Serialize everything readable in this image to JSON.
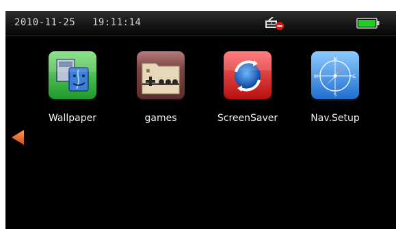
{
  "status_bar": {
    "date": "2010-11-25",
    "time": "19:11:14",
    "network_icon": "network-disconnected-icon",
    "battery_icon": "battery-full-icon"
  },
  "apps": [
    {
      "label": "Wallpaper",
      "icon": "wallpaper-icon"
    },
    {
      "label": "games",
      "icon": "games-icon"
    },
    {
      "label": "ScreenSaver",
      "icon": "screensaver-icon"
    },
    {
      "label": "Nav.Setup",
      "icon": "navigation-compass-icon"
    }
  ],
  "navigation": {
    "previous_arrow_icon": "arrow-left-icon"
  },
  "colors": {
    "battery": "#22cc22",
    "arrow": "#e8692a",
    "screen_bg": "#000000"
  }
}
